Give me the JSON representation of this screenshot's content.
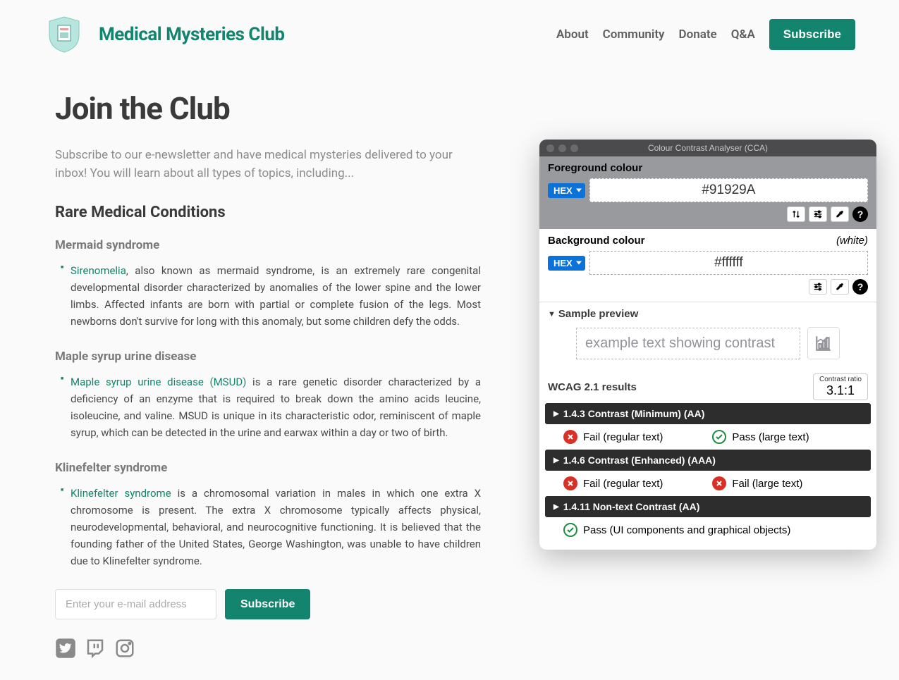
{
  "site": {
    "title": "Medical Mysteries Club"
  },
  "nav": {
    "items": [
      "About",
      "Community",
      "Donate",
      "Q&A"
    ],
    "subscribe": "Subscribe"
  },
  "page": {
    "title": "Join the Club",
    "intro": "Subscribe to our e-newsletter and have medical mysteries delivered to your inbox! You will learn about all types of topics, including...",
    "section_title": "Rare Medical Conditions"
  },
  "conditions": [
    {
      "name": "Mermaid syndrome",
      "link_text": "Sirenomelia",
      "body": ", also known as mermaid syndrome, is an extremely rare congenital developmental disorder characterized by anomalies of the lower spine and the lower limbs. Affected infants are born with partial or complete fusion of the legs. Most newborns don't survive for long with this anomaly, but some children defy the odds."
    },
    {
      "name": "Maple syrup urine disease",
      "link_text": "Maple syrup urine disease (MSUD)",
      "body": " is a rare genetic disorder characterized by a deficiency of an enzyme that is required to break down the amino acids leucine, isoleucine, and valine. MSUD is unique in its characteristic odor, reminiscent of maple syrup, which can be detected in the urine and earwax within a day or two of birth."
    },
    {
      "name": "Klinefelter syndrome",
      "link_text": "Klinefelter syndrome",
      "body": " is a chromosomal variation in males in which one extra X chromosome is present. The extra X chromosome typically affects physical, neurodevelopmental, behavioral, and neurocognitive functioning. It is believed that the founding father of the United States, George Washington, was unable to have children due to Klinefelter syndrome."
    }
  ],
  "form": {
    "email_placeholder": "Enter your e-mail address",
    "submit": "Subscribe"
  },
  "cca": {
    "title": "Colour Contrast Analyser (CCA)",
    "fg_label": "Foreground colour",
    "bg_label": "Background colour",
    "bg_note": "(white)",
    "hex_label": "HEX",
    "fg_value": "#91929A",
    "bg_value": "#ffffff",
    "sample_label": "Sample preview",
    "sample_text": "example text showing contrast",
    "results_title": "WCAG 2.1 results",
    "ratio_label": "Contrast ratio",
    "ratio_value": "3.1:1",
    "criteria": [
      {
        "title": "1.4.3 Contrast (Minimum) (AA)",
        "items": [
          {
            "pass": false,
            "text": "Fail (regular text)"
          },
          {
            "pass": true,
            "text": "Pass (large text)"
          }
        ]
      },
      {
        "title": "1.4.6 Contrast (Enhanced) (AAA)",
        "items": [
          {
            "pass": false,
            "text": "Fail (regular text)"
          },
          {
            "pass": false,
            "text": "Fail (large text)"
          }
        ]
      },
      {
        "title": "1.4.11 Non-text Contrast (AA)",
        "items": [
          {
            "pass": true,
            "text": "Pass (UI components and graphical objects)"
          }
        ]
      }
    ]
  }
}
